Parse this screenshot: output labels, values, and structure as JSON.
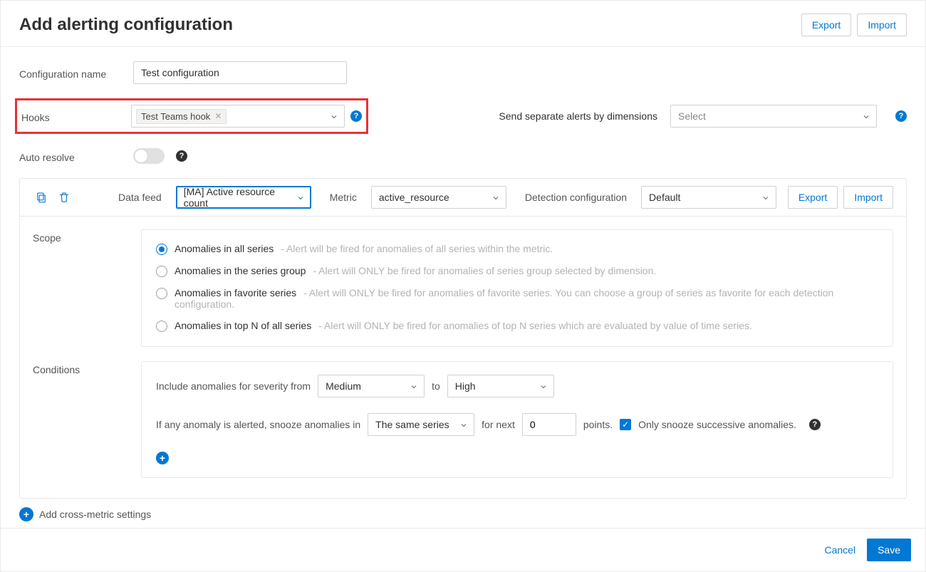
{
  "header": {
    "title": "Add alerting configuration",
    "export": "Export",
    "import": "Import"
  },
  "config": {
    "name_label": "Configuration name",
    "name_value": "Test configuration",
    "hooks_label": "Hooks",
    "hook_tag": "Test Teams hook",
    "dimensions_label": "Send separate alerts by dimensions",
    "dimensions_placeholder": "Select",
    "auto_resolve_label": "Auto resolve"
  },
  "panel": {
    "data_feed_label": "Data feed",
    "data_feed_value": "[MA] Active resource count",
    "metric_label": "Metric",
    "metric_value": "active_resource",
    "detection_label": "Detection configuration",
    "detection_value": "Default",
    "export": "Export",
    "import": "Import"
  },
  "scope": {
    "label": "Scope",
    "options": [
      {
        "title": "Anomalies in all series",
        "desc": "- Alert will be fired for anomalies of all series within the metric."
      },
      {
        "title": "Anomalies in the series group",
        "desc": "- Alert will ONLY be fired for anomalies of series group selected by dimension."
      },
      {
        "title": "Anomalies in favorite series",
        "desc": "- Alert will ONLY be fired for anomalies of favorite series. You can choose a group of series as favorite for each detection configuration."
      },
      {
        "title": "Anomalies in top N of all series",
        "desc": "- Alert will ONLY be fired for anomalies of top N series which are evaluated by value of time series."
      }
    ]
  },
  "conditions": {
    "label": "Conditions",
    "sev_prefix": "Include anomalies for severity from",
    "sev_from": "Medium",
    "sev_to_word": "to",
    "sev_to": "High",
    "snooze_prefix": "If any anomaly is alerted, snooze anomalies in",
    "snooze_scope": "The same series",
    "snooze_mid": "for next",
    "snooze_value": "0",
    "snooze_suffix": "points.",
    "only_successive": "Only snooze successive anomalies."
  },
  "cross_metric": "Add cross-metric settings",
  "footer": {
    "cancel": "Cancel",
    "save": "Save"
  }
}
